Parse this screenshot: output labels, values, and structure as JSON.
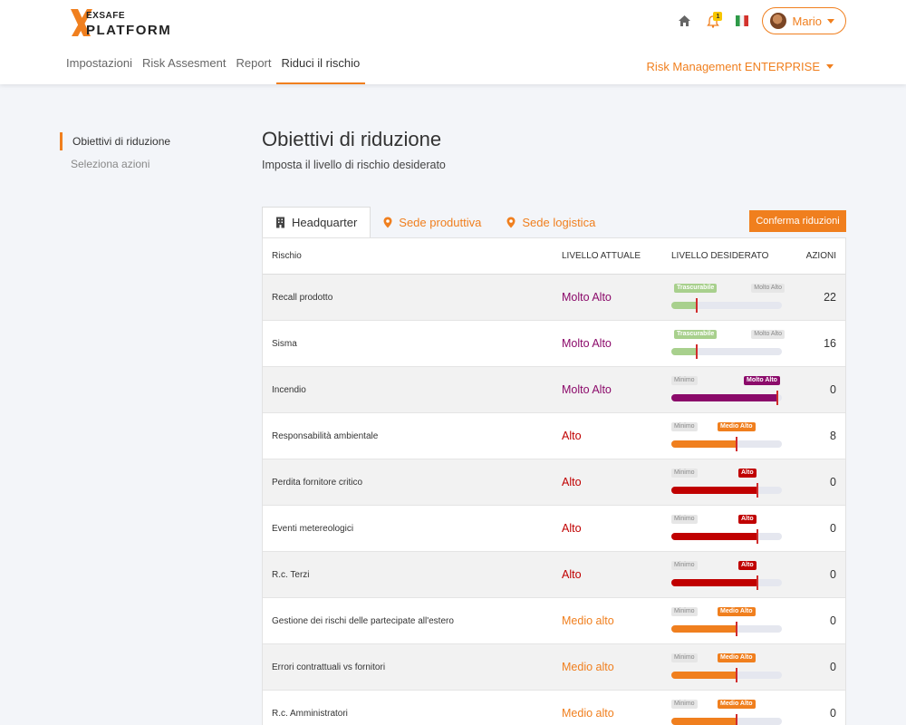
{
  "brand": {
    "name_top": "EXSAFE",
    "name_bottom": "PLATFORM",
    "accent": "#f07f1e"
  },
  "header": {
    "notifications": "1",
    "user": "Mario",
    "plan": "Risk Management ENTERPRISE"
  },
  "nav": [
    "Impostazioni",
    "Risk Assesment",
    "Report",
    "Riduci il rischio"
  ],
  "sidebar": [
    "Obiettivi di riduzione",
    "Seleziona azioni"
  ],
  "page": {
    "title": "Obiettivi di riduzione",
    "subtitle": "Imposta il livello di rischio desiderato"
  },
  "tabs": [
    "Headquarter",
    "Sede produttiva",
    "Sede logistica"
  ],
  "confirm": "Conferma riduzioni",
  "columns": [
    "Rischio",
    "LIVELLO ATTUALE",
    "LIVELLO DESIDERATO",
    "AZIONI"
  ],
  "colors": {
    "Molto Alto": "#8b0a6a",
    "Alto": "#c00000",
    "Medio alto": "#f07f1e",
    "Trascurabile": "#a8d08d"
  },
  "rows": [
    {
      "risk": "Recall prodotto",
      "current": "Molto Alto",
      "current_color": "#8b0a6a",
      "min": "Trascurabile",
      "max": "Molto Alto",
      "desired": "Trascurabile",
      "desired_color": "#a8d08d",
      "actions": "22",
      "target": 0.22,
      "actual": 0.22
    },
    {
      "risk": "Sisma",
      "current": "Molto Alto",
      "current_color": "#8b0a6a",
      "min": "Trascurabile",
      "max": "Molto Alto",
      "desired": "Trascurabile",
      "desired_color": "#a8d08d",
      "actions": "16",
      "target": 0.22,
      "actual": 0.22
    },
    {
      "risk": "Incendio",
      "current": "Molto Alto",
      "current_color": "#8b0a6a",
      "min": "Minimo",
      "max": "",
      "desired": "Molto Alto",
      "desired_color": "#8b0a6a",
      "actions": "0",
      "target": 0.95,
      "actual": 0.95
    },
    {
      "risk": "Responsabilità ambientale",
      "current": "Alto",
      "current_color": "#c00000",
      "min": "Minimo",
      "max": "",
      "desired": "Medio Alto",
      "desired_color": "#f07f1e",
      "actions": "8",
      "target": 0.58,
      "actual": 0.58
    },
    {
      "risk": "Perdita fornitore critico",
      "current": "Alto",
      "current_color": "#c00000",
      "min": "Minimo",
      "max": "",
      "desired": "Alto",
      "desired_color": "#c00000",
      "actions": "0",
      "target": 0.77,
      "actual": 0.77
    },
    {
      "risk": "Eventi metereologici",
      "current": "Alto",
      "current_color": "#c00000",
      "min": "Minimo",
      "max": "",
      "desired": "Alto",
      "desired_color": "#c00000",
      "actions": "0",
      "target": 0.77,
      "actual": 0.77
    },
    {
      "risk": "R.c. Terzi",
      "current": "Alto",
      "current_color": "#c00000",
      "min": "Minimo",
      "max": "",
      "desired": "Alto",
      "desired_color": "#c00000",
      "actions": "0",
      "target": 0.77,
      "actual": 0.77
    },
    {
      "risk": "Gestione dei rischi delle partecipate all'estero",
      "current": "Medio alto",
      "current_color": "#f07f1e",
      "min": "Minimo",
      "max": "",
      "desired": "Medio Alto",
      "desired_color": "#f07f1e",
      "actions": "0",
      "target": 0.58,
      "actual": 0.58
    },
    {
      "risk": "Errori contrattuali vs fornitori",
      "current": "Medio alto",
      "current_color": "#f07f1e",
      "min": "Minimo",
      "max": "",
      "desired": "Medio Alto",
      "desired_color": "#f07f1e",
      "actions": "0",
      "target": 0.58,
      "actual": 0.58
    },
    {
      "risk": "R.c. Amministratori",
      "current": "Medio alto",
      "current_color": "#f07f1e",
      "min": "Minimo",
      "max": "",
      "desired": "Medio Alto",
      "desired_color": "#f07f1e",
      "actions": "0",
      "target": 0.58,
      "actual": 0.58
    }
  ]
}
